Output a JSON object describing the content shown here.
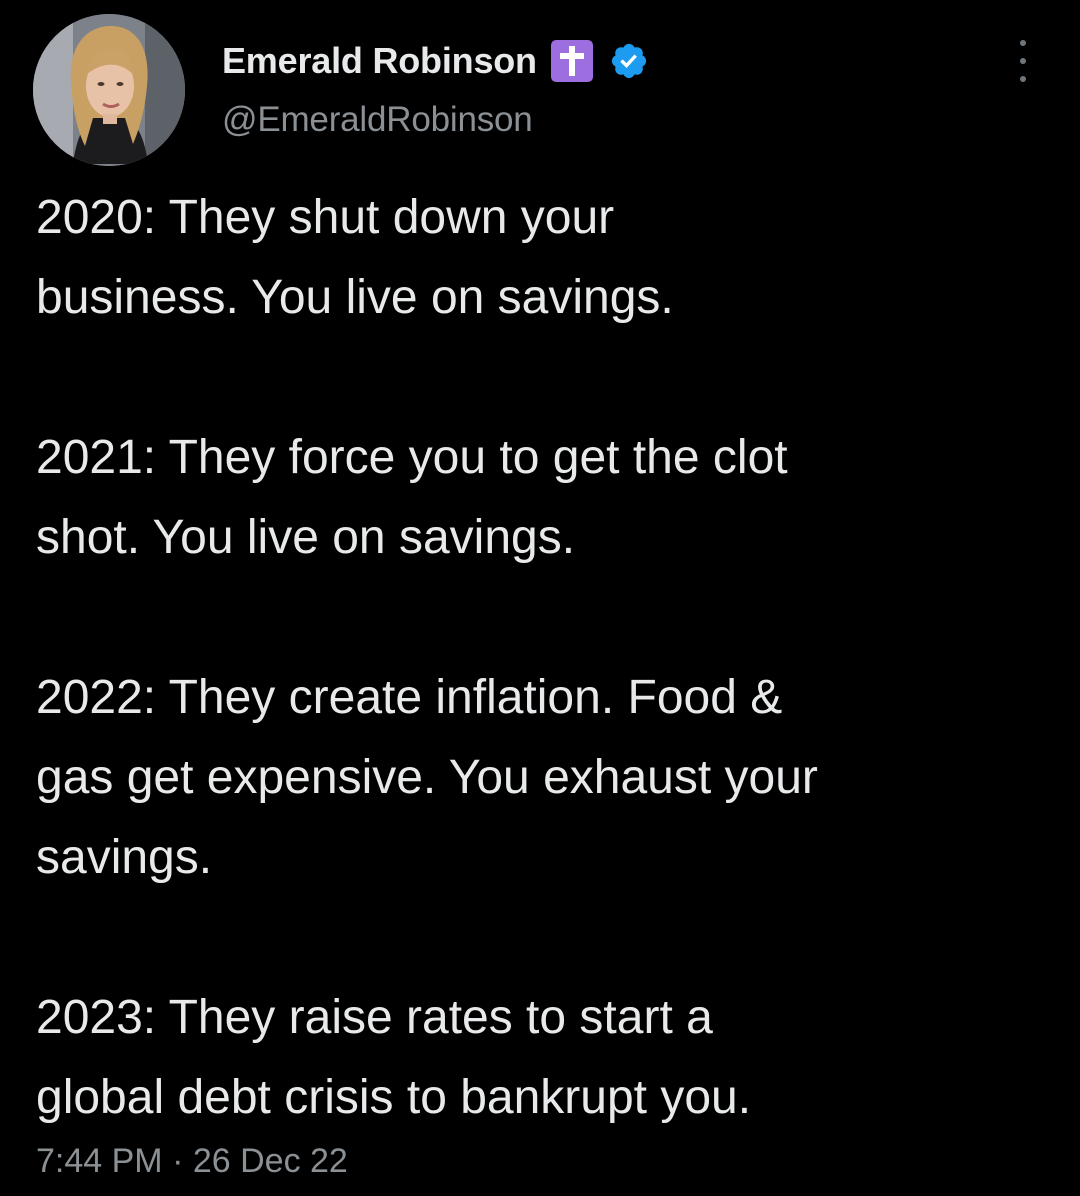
{
  "author": {
    "name": "Emerald Robinson",
    "handle": "@EmeraldRobinson",
    "badges": [
      "cross-icon",
      "verified-icon"
    ],
    "verified_color": "#1d9bf0",
    "cross_badge_color": "#9c6ee0"
  },
  "tweet": {
    "paragraphs": [
      [
        "2020: They shut down your",
        "business. You live on savings."
      ],
      [
        "2021: They force you to get the clot",
        "shot. You live on savings."
      ],
      [
        "2022: They create inflation. Food &",
        "gas get expensive. You exhaust your",
        "savings."
      ],
      [
        "2023: They raise rates to start a",
        "global debt crisis to bankrupt you."
      ]
    ],
    "timestamp": "7:44 PM · 26 Dec 22"
  },
  "icons": {
    "more": "more-options-icon"
  },
  "colors": {
    "background": "#000000",
    "text": "#e7e9ea",
    "secondary_text": "#8b9095"
  }
}
